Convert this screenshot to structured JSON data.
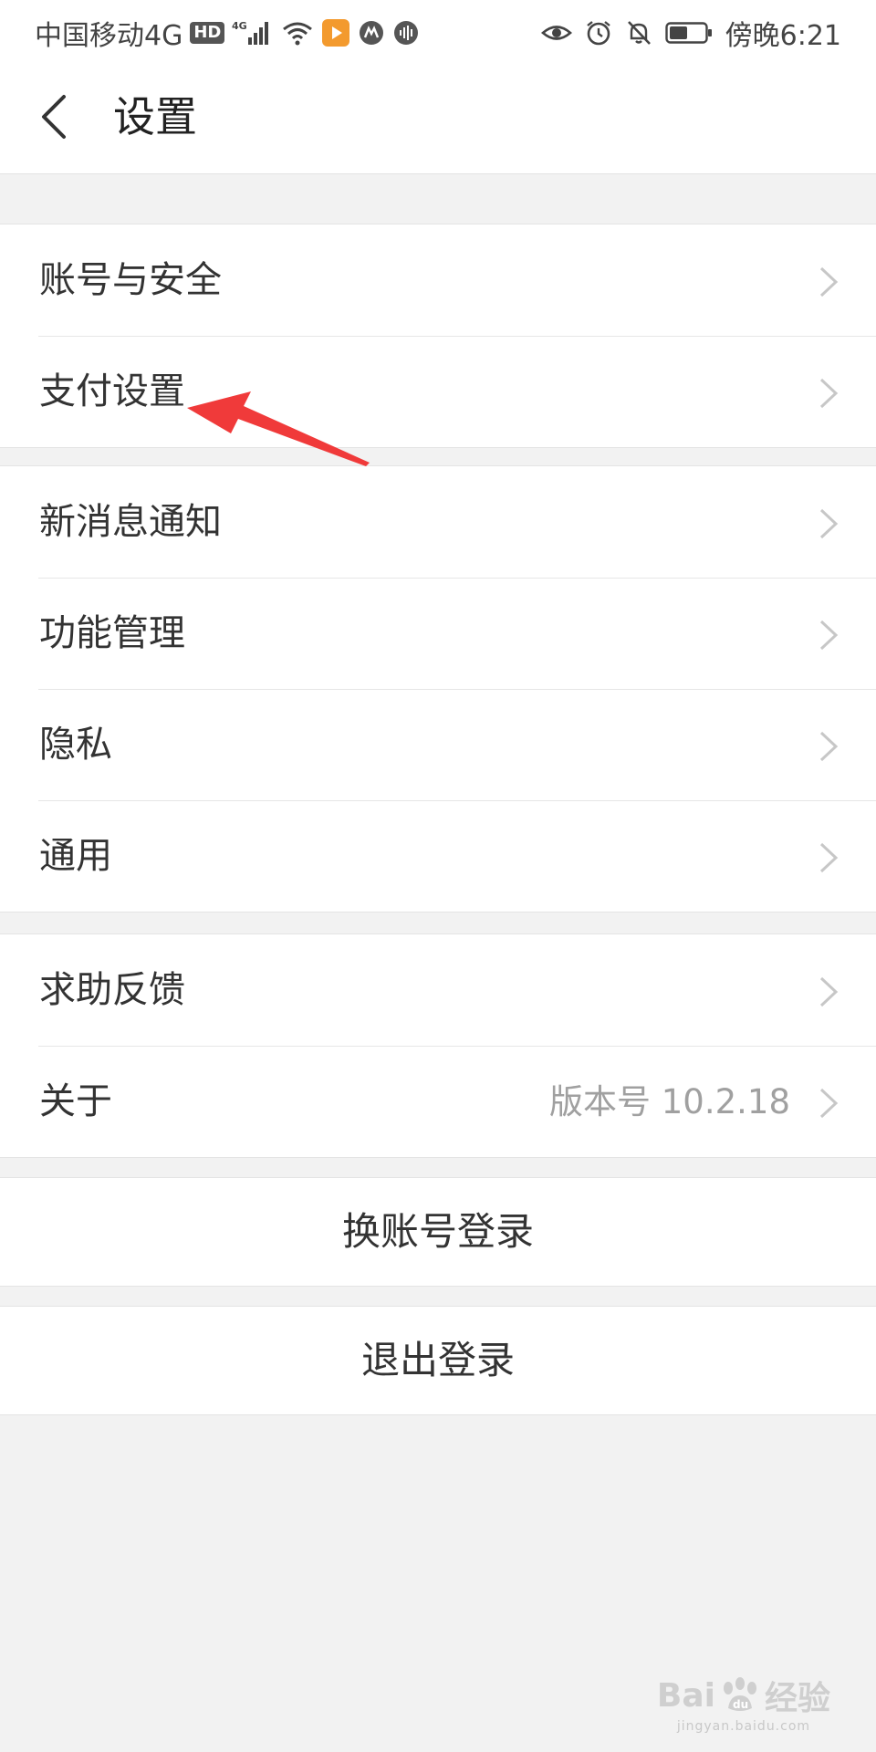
{
  "status_bar": {
    "carrier": "中国移动4G",
    "hd_badge": "HD",
    "network_label": "4G",
    "time": "傍晚6:21"
  },
  "header": {
    "title": "设置"
  },
  "groups": [
    {
      "items": [
        {
          "label": "账号与安全"
        },
        {
          "label": "支付设置"
        }
      ]
    },
    {
      "items": [
        {
          "label": "新消息通知"
        },
        {
          "label": "功能管理"
        },
        {
          "label": "隐私"
        },
        {
          "label": "通用"
        }
      ]
    },
    {
      "items": [
        {
          "label": "求助反馈"
        },
        {
          "label": "关于",
          "value": "版本号 10.2.18"
        }
      ]
    }
  ],
  "actions": {
    "switch_account": "换账号登录",
    "logout": "退出登录"
  },
  "annotation": {
    "color": "#f03a3a"
  },
  "watermark": {
    "brand": "Bai",
    "brand_suffix": "经验",
    "url": "jingyan.baidu.com"
  },
  "colors": {
    "background": "#f2f2f2",
    "surface": "#ffffff",
    "text": "#333333",
    "secondary_text": "#a0a0a0",
    "chevron": "#c7c7c7"
  }
}
